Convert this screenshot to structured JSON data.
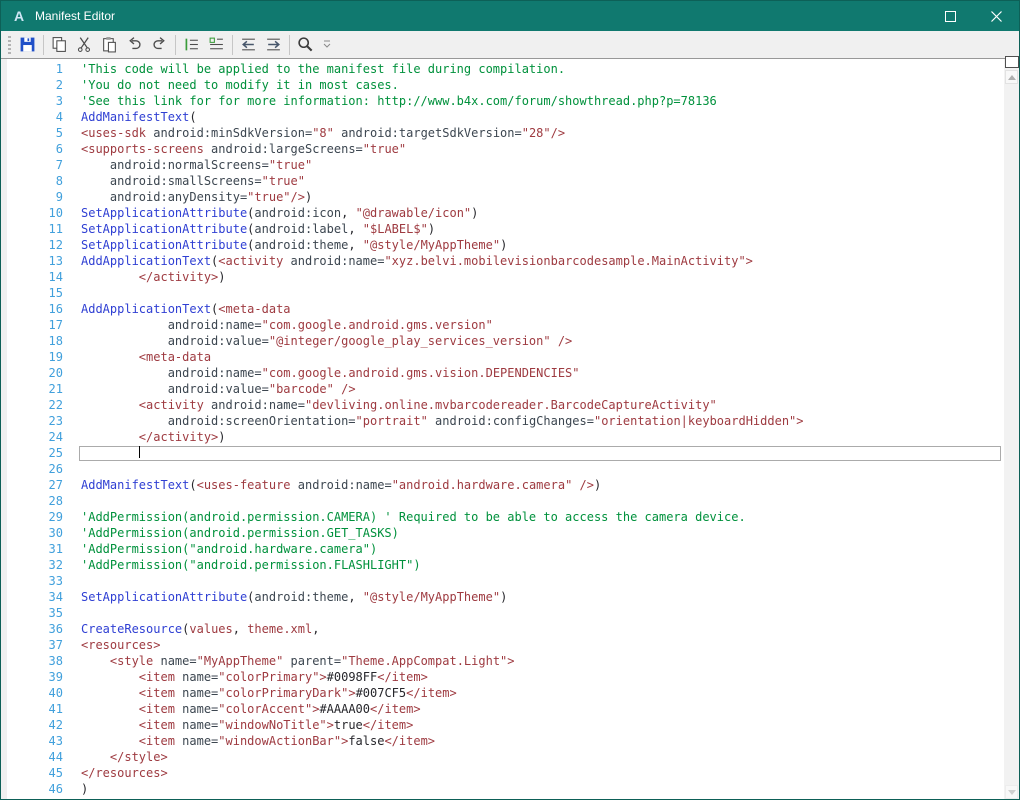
{
  "window": {
    "title": "Manifest Editor",
    "app_icon_letter": "A"
  },
  "titlebar_controls": [
    {
      "name": "maximize",
      "label": "Maximize"
    },
    {
      "name": "close",
      "label": "Close"
    }
  ],
  "toolbar": {
    "items": [
      {
        "type": "button",
        "name": "save",
        "label": "Save"
      },
      {
        "type": "sep"
      },
      {
        "type": "button",
        "name": "copy",
        "label": "Copy"
      },
      {
        "type": "button",
        "name": "cut",
        "label": "Cut"
      },
      {
        "type": "button",
        "name": "paste",
        "label": "Paste"
      },
      {
        "type": "button",
        "name": "undo",
        "label": "Undo"
      },
      {
        "type": "button",
        "name": "redo",
        "label": "Redo"
      },
      {
        "type": "sep"
      },
      {
        "type": "button",
        "name": "indent",
        "label": "Indent"
      },
      {
        "type": "button",
        "name": "outdent",
        "label": "Outdent"
      },
      {
        "type": "sep"
      },
      {
        "type": "button",
        "name": "shift-left",
        "label": "Shift Left"
      },
      {
        "type": "button",
        "name": "shift-right",
        "label": "Shift Right"
      },
      {
        "type": "sep"
      },
      {
        "type": "button",
        "name": "search",
        "label": "Search"
      },
      {
        "type": "overflow",
        "name": "toolbar-overflow",
        "label": "More options"
      }
    ]
  },
  "colors": {
    "titlebar": "#10796F",
    "keyword": "#2F3FD3",
    "comment": "#00913C",
    "string_tag": "#9E3A40",
    "attribute": "#3C4650",
    "plain": "#26262B",
    "line_number": "#41A0DC",
    "save_icon": "#2050C8"
  },
  "editor": {
    "cursor": {
      "line": 25,
      "col": 8
    },
    "lines": [
      {
        "n": 1,
        "seg": [
          [
            "c",
            "'This code will be applied to the manifest file during compilation."
          ]
        ]
      },
      {
        "n": 2,
        "seg": [
          [
            "c",
            "'You do not need to modify it in most cases."
          ]
        ]
      },
      {
        "n": 3,
        "seg": [
          [
            "c",
            "'See this link for for more information: http://www.b4x.com/forum/showthread.php?p=78136"
          ]
        ]
      },
      {
        "n": 4,
        "seg": [
          [
            "k",
            "AddManifestText"
          ],
          [
            "p",
            "("
          ]
        ]
      },
      {
        "n": 5,
        "seg": [
          [
            "m",
            "<uses-sdk "
          ],
          [
            "a",
            "android:minSdkVersion="
          ],
          [
            "m",
            "\"8\" "
          ],
          [
            "a",
            "android:targetSdkVersion="
          ],
          [
            "m",
            "\"28\"/>"
          ]
        ]
      },
      {
        "n": 6,
        "seg": [
          [
            "m",
            "<supports-screens "
          ],
          [
            "a",
            "android:largeScreens="
          ],
          [
            "m",
            "\"true\""
          ]
        ]
      },
      {
        "n": 7,
        "seg": [
          [
            "a",
            "    android:normalScreens="
          ],
          [
            "m",
            "\"true\""
          ]
        ]
      },
      {
        "n": 8,
        "seg": [
          [
            "a",
            "    android:smallScreens="
          ],
          [
            "m",
            "\"true\""
          ]
        ]
      },
      {
        "n": 9,
        "seg": [
          [
            "a",
            "    android:anyDensity="
          ],
          [
            "m",
            "\"true\"/>"
          ],
          [
            "p",
            ")"
          ]
        ]
      },
      {
        "n": 10,
        "seg": [
          [
            "k",
            "SetApplicationAttribute"
          ],
          [
            "p",
            "("
          ],
          [
            "a",
            "android:icon"
          ],
          [
            "p",
            ", "
          ],
          [
            "m",
            "\"@drawable/icon\""
          ],
          [
            "p",
            ")"
          ]
        ]
      },
      {
        "n": 11,
        "seg": [
          [
            "k",
            "SetApplicationAttribute"
          ],
          [
            "p",
            "("
          ],
          [
            "a",
            "android:label"
          ],
          [
            "p",
            ", "
          ],
          [
            "m",
            "\"$LABEL$\""
          ],
          [
            "p",
            ")"
          ]
        ]
      },
      {
        "n": 12,
        "seg": [
          [
            "k",
            "SetApplicationAttribute"
          ],
          [
            "p",
            "("
          ],
          [
            "a",
            "android:theme"
          ],
          [
            "p",
            ", "
          ],
          [
            "m",
            "\"@style/MyAppTheme\""
          ],
          [
            "p",
            ")"
          ]
        ]
      },
      {
        "n": 13,
        "seg": [
          [
            "k",
            "AddApplicationText"
          ],
          [
            "p",
            "("
          ],
          [
            "m",
            "<activity "
          ],
          [
            "a",
            "android:name="
          ],
          [
            "m",
            "\"xyz.belvi.mobilevisionbarcodesample.MainActivity\">"
          ]
        ]
      },
      {
        "n": 14,
        "seg": [
          [
            "m",
            "        </activity>"
          ],
          [
            "p",
            ")"
          ]
        ]
      },
      {
        "n": 15,
        "seg": []
      },
      {
        "n": 16,
        "seg": [
          [
            "k",
            "AddApplicationText"
          ],
          [
            "p",
            "("
          ],
          [
            "m",
            "<meta-data"
          ]
        ]
      },
      {
        "n": 17,
        "seg": [
          [
            "a",
            "            android:name="
          ],
          [
            "m",
            "\"com.google.android.gms.version\""
          ]
        ]
      },
      {
        "n": 18,
        "seg": [
          [
            "a",
            "            android:value="
          ],
          [
            "m",
            "\"@integer/google_play_services_version\" />"
          ]
        ]
      },
      {
        "n": 19,
        "seg": [
          [
            "m",
            "        <meta-data"
          ]
        ]
      },
      {
        "n": 20,
        "seg": [
          [
            "a",
            "            android:name="
          ],
          [
            "m",
            "\"com.google.android.gms.vision.DEPENDENCIES\""
          ]
        ]
      },
      {
        "n": 21,
        "seg": [
          [
            "a",
            "            android:value="
          ],
          [
            "m",
            "\"barcode\" />"
          ]
        ]
      },
      {
        "n": 22,
        "seg": [
          [
            "m",
            "        <activity "
          ],
          [
            "a",
            "android:name="
          ],
          [
            "m",
            "\"devliving.online.mvbarcodereader.BarcodeCaptureActivity\""
          ]
        ]
      },
      {
        "n": 23,
        "seg": [
          [
            "a",
            "            android:screenOrientation="
          ],
          [
            "m",
            "\"portrait\" "
          ],
          [
            "a",
            "android:configChanges="
          ],
          [
            "m",
            "\"orientation|keyboardHidden\">"
          ]
        ]
      },
      {
        "n": 24,
        "seg": [
          [
            "m",
            "        </activity>"
          ],
          [
            "p",
            ")"
          ]
        ]
      },
      {
        "n": 25,
        "seg": []
      },
      {
        "n": 26,
        "seg": []
      },
      {
        "n": 27,
        "seg": [
          [
            "k",
            "AddManifestText"
          ],
          [
            "p",
            "("
          ],
          [
            "m",
            "<uses-feature "
          ],
          [
            "a",
            "android:name="
          ],
          [
            "m",
            "\"android.hardware.camera\" />"
          ],
          [
            "p",
            ")"
          ]
        ]
      },
      {
        "n": 28,
        "seg": []
      },
      {
        "n": 29,
        "seg": [
          [
            "c",
            "'AddPermission(android.permission.CAMERA) ' Required to be able to access the camera device."
          ]
        ]
      },
      {
        "n": 30,
        "seg": [
          [
            "c",
            "'AddPermission(android.permission.GET_TASKS)"
          ]
        ]
      },
      {
        "n": 31,
        "seg": [
          [
            "c",
            "'AddPermission(\"android.hardware.camera\")"
          ]
        ]
      },
      {
        "n": 32,
        "seg": [
          [
            "c",
            "'AddPermission(\"android.permission.FLASHLIGHT\")"
          ]
        ]
      },
      {
        "n": 33,
        "seg": []
      },
      {
        "n": 34,
        "seg": [
          [
            "k",
            "SetApplicationAttribute"
          ],
          [
            "p",
            "("
          ],
          [
            "a",
            "android:theme"
          ],
          [
            "p",
            ", "
          ],
          [
            "m",
            "\"@style/MyAppTheme\""
          ],
          [
            "p",
            ")"
          ]
        ]
      },
      {
        "n": 35,
        "seg": []
      },
      {
        "n": 36,
        "seg": [
          [
            "k",
            "CreateResource"
          ],
          [
            "p",
            "("
          ],
          [
            "m",
            "values"
          ],
          [
            "p",
            ", "
          ],
          [
            "m",
            "theme.xml"
          ],
          [
            "p",
            ","
          ]
        ]
      },
      {
        "n": 37,
        "seg": [
          [
            "m",
            "<resources>"
          ]
        ]
      },
      {
        "n": 38,
        "seg": [
          [
            "m",
            "    <style "
          ],
          [
            "a",
            "name="
          ],
          [
            "m",
            "\"MyAppTheme\" "
          ],
          [
            "a",
            "parent="
          ],
          [
            "m",
            "\"Theme.AppCompat.Light\">"
          ]
        ]
      },
      {
        "n": 39,
        "seg": [
          [
            "m",
            "        <item "
          ],
          [
            "a",
            "name="
          ],
          [
            "m",
            "\"colorPrimary\">"
          ],
          [
            "p",
            "#0098FF"
          ],
          [
            "m",
            "</item>"
          ]
        ]
      },
      {
        "n": 40,
        "seg": [
          [
            "m",
            "        <item "
          ],
          [
            "a",
            "name="
          ],
          [
            "m",
            "\"colorPrimaryDark\">"
          ],
          [
            "p",
            "#007CF5"
          ],
          [
            "m",
            "</item>"
          ]
        ]
      },
      {
        "n": 41,
        "seg": [
          [
            "m",
            "        <item "
          ],
          [
            "a",
            "name="
          ],
          [
            "m",
            "\"colorAccent\">"
          ],
          [
            "p",
            "#AAAA00"
          ],
          [
            "m",
            "</item>"
          ]
        ]
      },
      {
        "n": 42,
        "seg": [
          [
            "m",
            "        <item "
          ],
          [
            "a",
            "name="
          ],
          [
            "m",
            "\"windowNoTitle\">"
          ],
          [
            "p",
            "true"
          ],
          [
            "m",
            "</item>"
          ]
        ]
      },
      {
        "n": 43,
        "seg": [
          [
            "m",
            "        <item "
          ],
          [
            "a",
            "name="
          ],
          [
            "m",
            "\"windowActionBar\">"
          ],
          [
            "p",
            "false"
          ],
          [
            "m",
            "</item>"
          ]
        ]
      },
      {
        "n": 44,
        "seg": [
          [
            "m",
            "    </style>"
          ]
        ]
      },
      {
        "n": 45,
        "seg": [
          [
            "m",
            "</resources>"
          ]
        ]
      },
      {
        "n": 46,
        "seg": [
          [
            "p",
            ")"
          ]
        ]
      }
    ]
  }
}
